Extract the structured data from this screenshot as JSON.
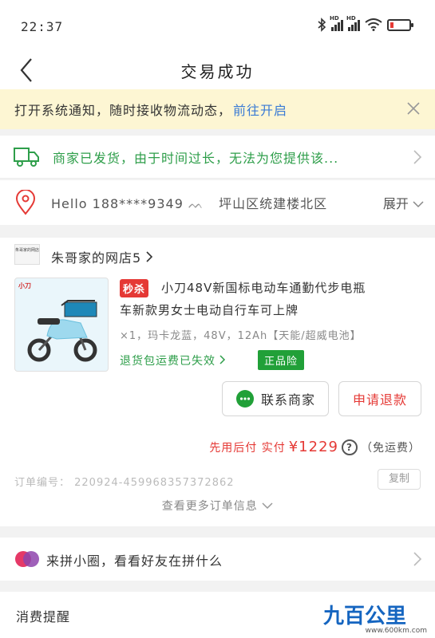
{
  "status_bar": {
    "time": "22:37"
  },
  "nav": {
    "title": "交易成功"
  },
  "notice": {
    "text": "打开系统通知，随时接收物流动态，",
    "link": "前往开启"
  },
  "shipping": {
    "text": "商家已发货，由于时间过长，无法为您提供该..."
  },
  "address": {
    "text": "Hello 188****9349",
    "district": "坪山区统建楼北区",
    "expand": "展开"
  },
  "shop": {
    "logo_text": "朱哥家的网店",
    "name": "朱哥家的网店5"
  },
  "product": {
    "brand": "小刀",
    "sale_tag": "秒杀",
    "title_line1": "小刀48V新国标电动车通勤代步电瓶",
    "title_line2": "车新款男女士电动自行车可上牌",
    "sku": "×1，玛卡龙蓝，48V，12Ah【天能/超威电池】",
    "return_fee": "退货包运费已失效",
    "badge": "正品险"
  },
  "buttons": {
    "contact": "联系商家",
    "refund": "申请退款"
  },
  "payment": {
    "label": "先用后付 实付",
    "amount": "¥1229",
    "help": "?",
    "note": "（免运费）"
  },
  "order_info": {
    "order_no": "订单编号：  220924-459968357372862",
    "copy": "复制",
    "more": "查看更多订单信息"
  },
  "group_buy": {
    "text": "来拼小圈，看看好友在拼什么"
  },
  "tips": {
    "text": "消费提醒"
  },
  "watermark": {
    "logo": "九百公里",
    "url": "www.600km.com"
  },
  "colors": {
    "accent_red": "#e53935",
    "green": "#2e9e4a",
    "link_blue": "#3a7bd5",
    "notice_bg": "#fdf6d3"
  }
}
